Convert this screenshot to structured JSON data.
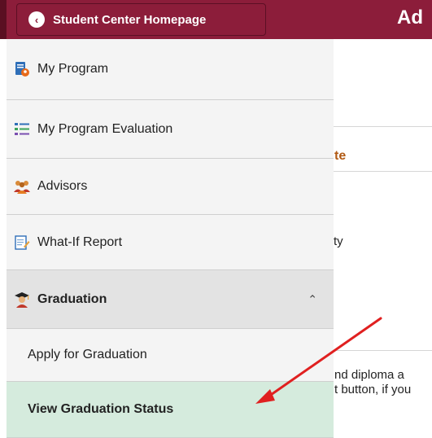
{
  "header": {
    "back_button_label": "Student Center Homepage",
    "title_partial": "Ad"
  },
  "menu": {
    "items": [
      {
        "label": "My Program",
        "icon": "program-document-icon"
      },
      {
        "label": "My Program Evaluation",
        "icon": "evaluation-list-icon"
      },
      {
        "label": "Advisors",
        "icon": "people-group-icon"
      },
      {
        "label": "What-If Report",
        "icon": "report-edit-icon"
      }
    ],
    "group": {
      "label": "Graduation",
      "icon": "graduate-icon",
      "expanded": true
    },
    "sub_items": [
      {
        "label": "Apply for Graduation",
        "selected": false
      },
      {
        "label": "View Graduation Status",
        "selected": true
      }
    ]
  },
  "background": {
    "heading_fragment": "te",
    "text_fragment_1": "ty",
    "text_fragment_2": "nd diploma a",
    "text_fragment_3": "t button, if you"
  },
  "colors": {
    "header": "#8c1d3a",
    "selected_item": "#d5ebdd",
    "arrow": "#e02020"
  }
}
